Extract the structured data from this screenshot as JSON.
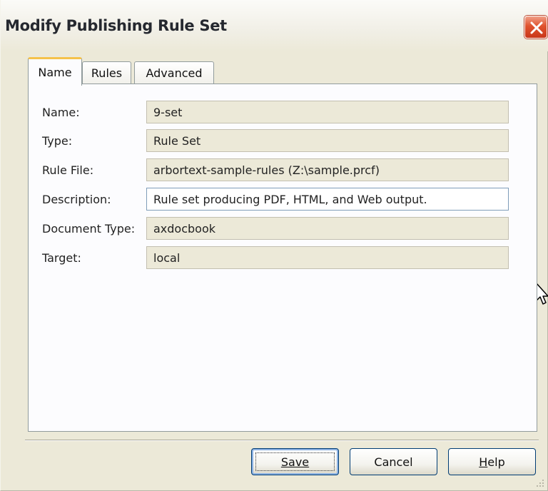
{
  "window": {
    "title": "Modify Publishing Rule Set",
    "close_icon": "close-icon"
  },
  "tabs": [
    {
      "label": "Name",
      "active": true
    },
    {
      "label": "Rules",
      "active": false
    },
    {
      "label": "Advanced",
      "active": false
    }
  ],
  "fields": [
    {
      "label": "Name:",
      "value": "9-set",
      "editable": false
    },
    {
      "label": "Type:",
      "value": "Rule Set",
      "editable": false
    },
    {
      "label": "Rule File:",
      "value": "arbortext-sample-rules (Z:\\sample.prcf)",
      "editable": false
    },
    {
      "label": "Description:",
      "value": "Rule set producing PDF, HTML, and Web output.",
      "editable": true
    },
    {
      "label": "Document Type:",
      "value": "axdocbook",
      "editable": false
    },
    {
      "label": "Target:",
      "value": "local",
      "editable": false
    }
  ],
  "buttons": {
    "save": {
      "label": "Save",
      "mnemonic": "S"
    },
    "cancel": {
      "label": "Cancel"
    },
    "help": {
      "label": "Help",
      "mnemonic": "H"
    }
  },
  "colors": {
    "dialog_bg": "#ECE9D8",
    "panel_bg": "#FCFCFE",
    "active_tab_accent": "#F5C24A",
    "close_button": "#E0532E"
  }
}
